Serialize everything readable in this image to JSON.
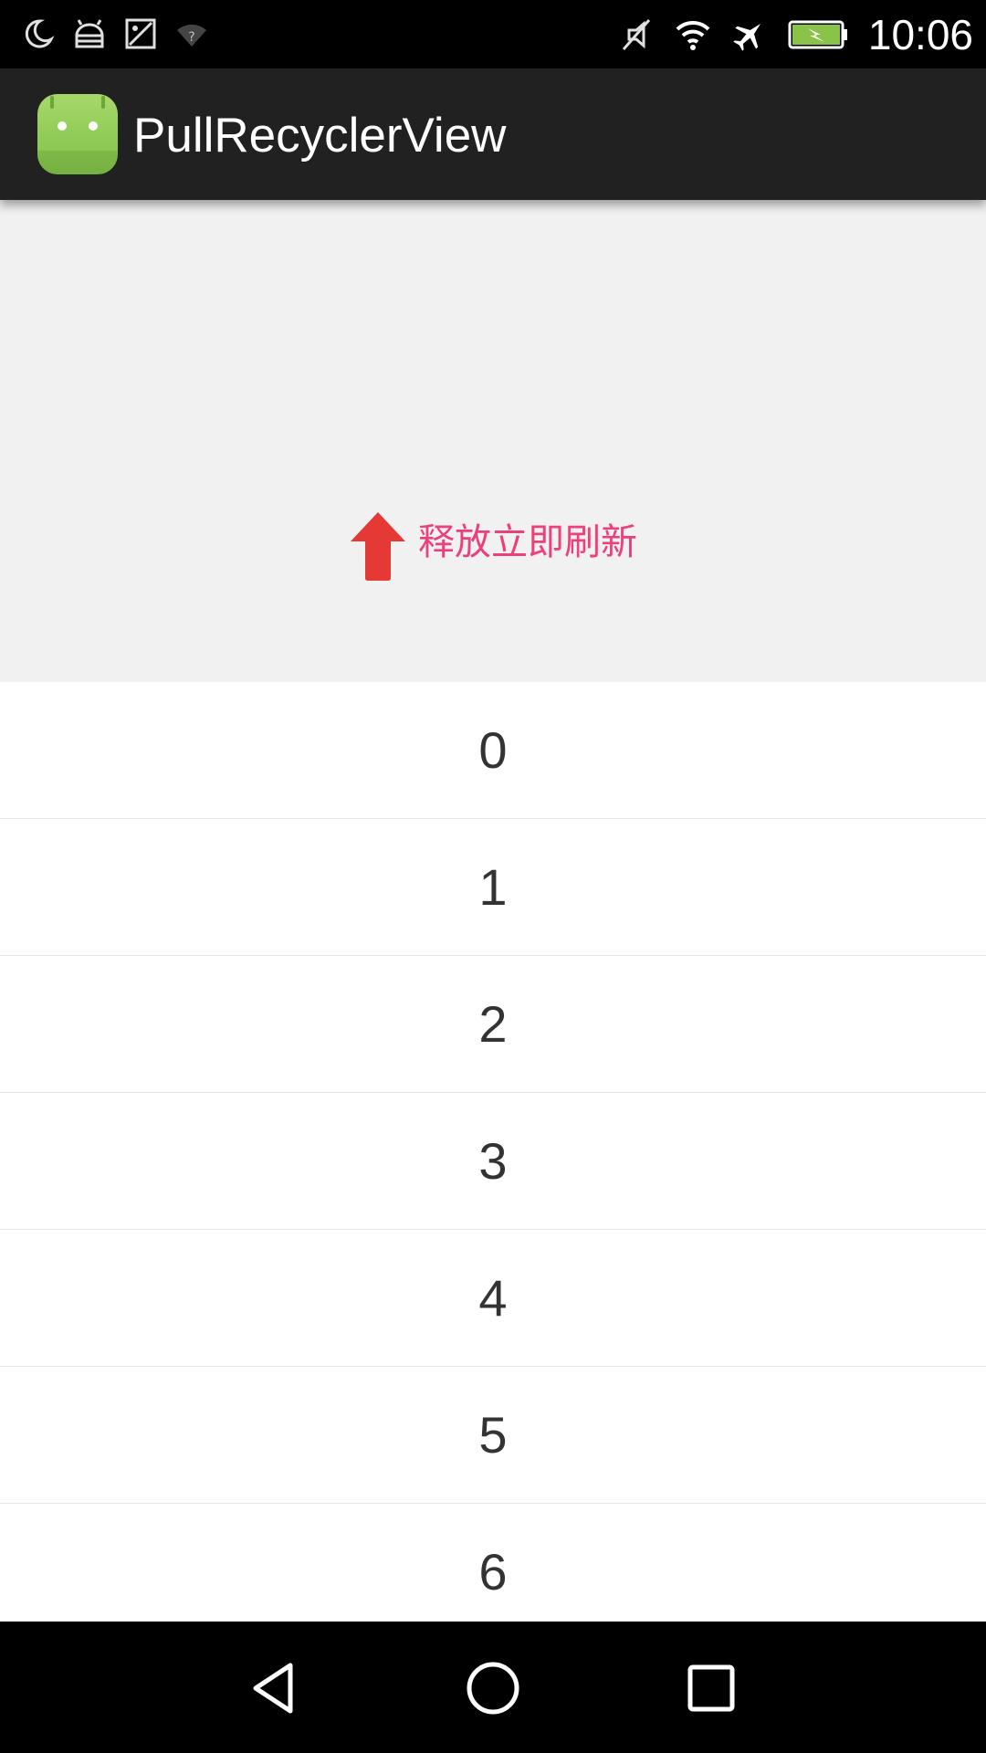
{
  "status_bar": {
    "left_icons": [
      "moon-icon",
      "android-debug-icon",
      "image-icon",
      "wifi-unknown-icon"
    ],
    "right_icons": [
      "mute-icon",
      "wifi-icon",
      "airplane-icon",
      "battery-charging-icon"
    ],
    "time": "10:06",
    "battery_color": "#8bc34a"
  },
  "action_bar": {
    "app_icon": "android-app-icon",
    "title": "PullRecyclerView"
  },
  "refresh_header": {
    "arrow_icon": "up-arrow-icon",
    "arrow_color": "#e53935",
    "text": "释放立即刷新",
    "text_color": "#ec407a"
  },
  "list": {
    "items": [
      "0",
      "1",
      "2",
      "3",
      "4",
      "5",
      "6"
    ]
  },
  "nav_bar": {
    "buttons": [
      "back-icon",
      "home-icon",
      "recents-icon"
    ]
  }
}
